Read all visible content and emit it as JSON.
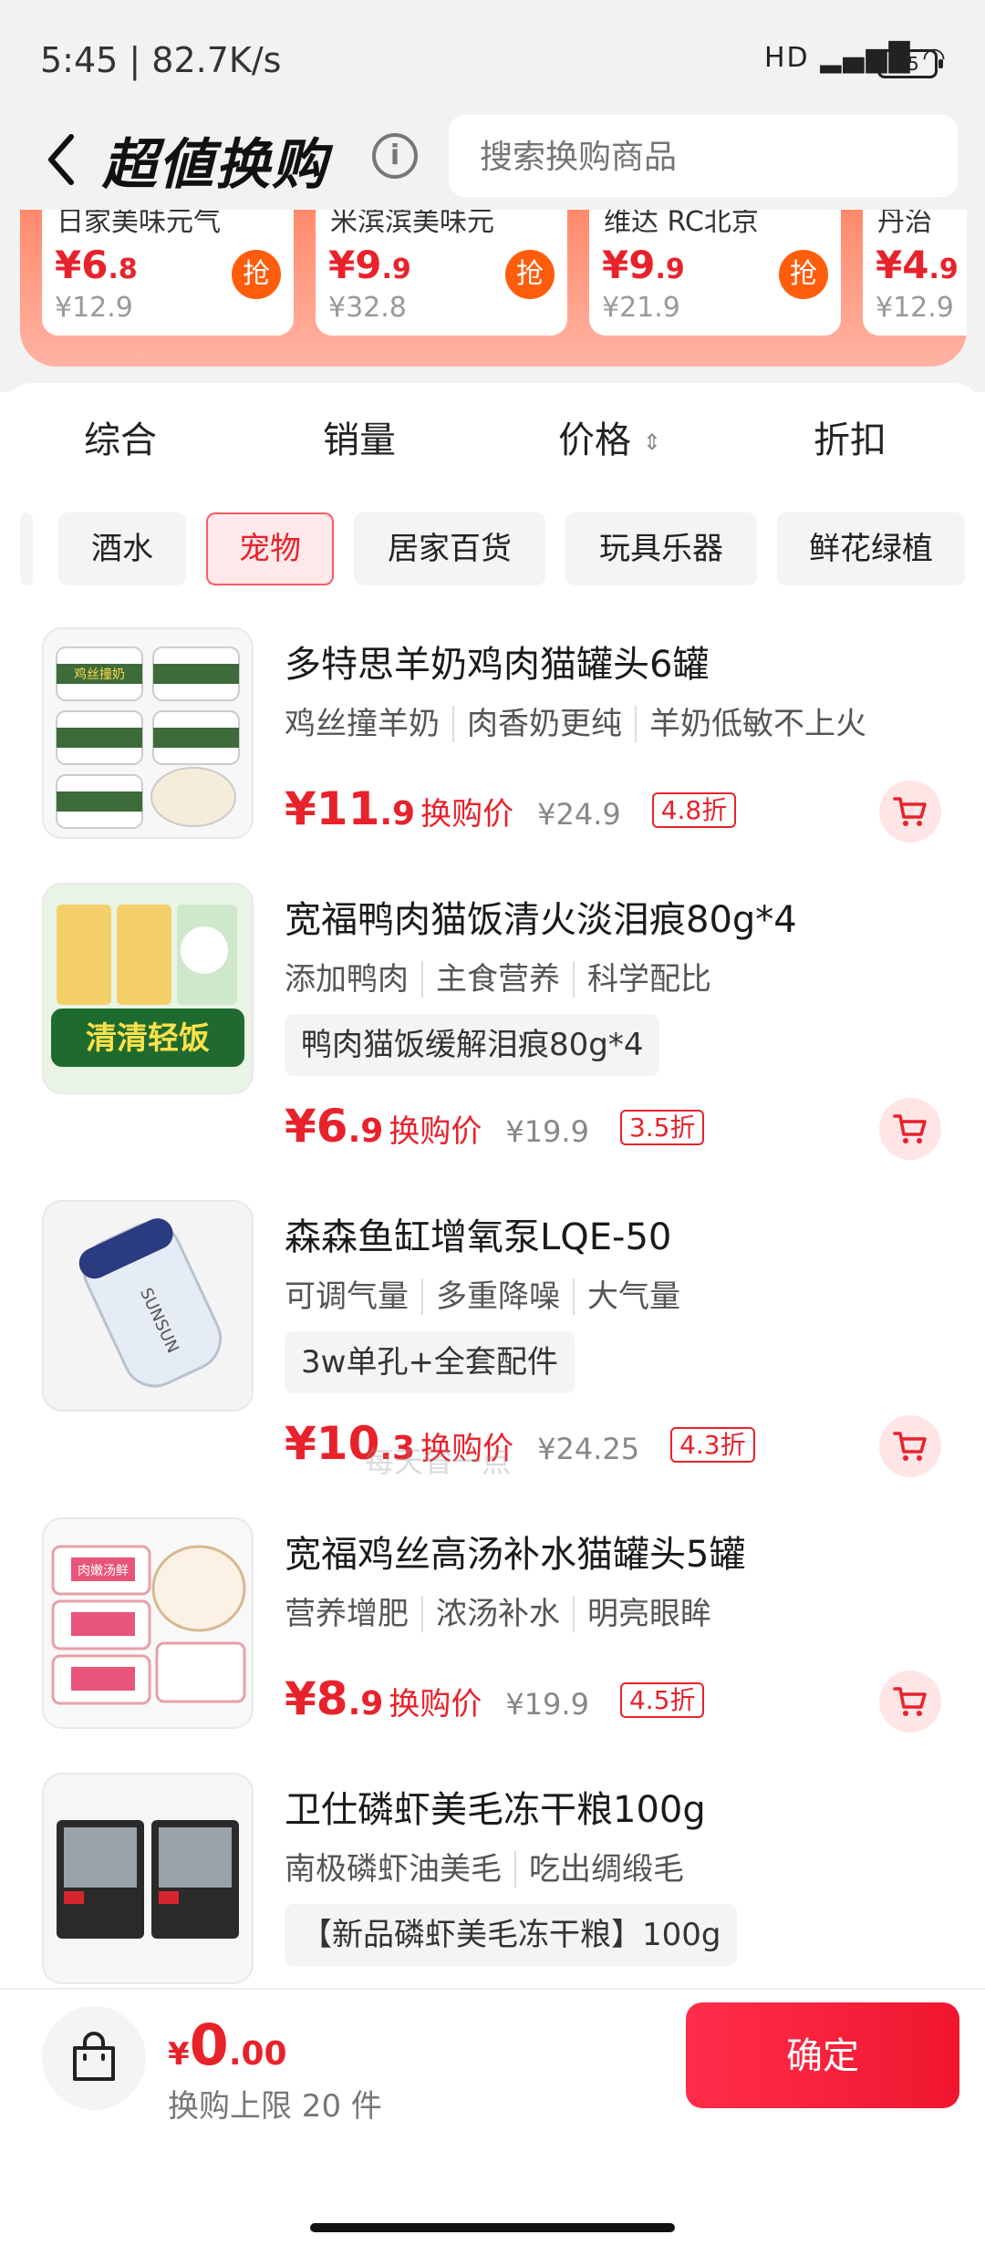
{
  "status_bar": {
    "time": "5:45 | 82.7K/s",
    "signal": "HD ▂▄▆█ ◠",
    "battery": "45"
  },
  "header": {
    "title": "超値换购",
    "search_placeholder": "搜索换购商品"
  },
  "deals": [
    {
      "name": "日家美味元气",
      "price_int": "¥6",
      "price_dec": ".8",
      "old": "¥12.9",
      "grab": "抢"
    },
    {
      "name": "米滨滨美味元",
      "price_int": "¥9",
      "price_dec": ".9",
      "old": "¥32.8",
      "grab": "抢"
    },
    {
      "name": "维达 RC北京",
      "price_int": "¥9",
      "price_dec": ".9",
      "old": "¥21.9",
      "grab": "抢"
    },
    {
      "name": "丹治",
      "price_int": "¥4",
      "price_dec": ".9",
      "old": "¥12.9",
      "grab": ""
    }
  ],
  "sort_tabs": {
    "overall": "综合",
    "sales": "销量",
    "price": "价格",
    "discount": "折扣"
  },
  "categories": [
    "酒水",
    "宠物",
    "居家百货",
    "玩具乐器",
    "鲜花绿植"
  ],
  "products": [
    {
      "name": "多特思羊奶鸡肉猫罐头6罐",
      "tags": [
        "鸡丝撞羊奶",
        "肉香奶更纯",
        "羊奶低敏不上火"
      ],
      "price_int": "¥11",
      "price_dec": ".9",
      "label": "换购价",
      "old": "¥24.9",
      "discount": "4.8折"
    },
    {
      "name": "宽福鸭肉猫饭清火淡泪痕80g*4",
      "tags": [
        "添加鸭肉",
        "主食营养",
        "科学配比"
      ],
      "spec": "鸭肉猫饭缓解泪痕80g*4",
      "price_int": "¥6",
      "price_dec": ".9",
      "label": "换购价",
      "old": "¥19.9",
      "discount": "3.5折"
    },
    {
      "name": "森森鱼缸增氧泵LQE-50",
      "tags": [
        "可调气量",
        "多重降噪",
        "大气量"
      ],
      "spec": "3w单孔+全套配件",
      "price_int": "¥10",
      "price_dec": ".3",
      "label": "换购价",
      "old": "¥24.25",
      "discount": "4.3折"
    },
    {
      "name": "宽福鸡丝高汤补水猫罐头5罐",
      "tags": [
        "营养增肥",
        "浓汤补水",
        "明亮眼眸"
      ],
      "price_int": "¥8",
      "price_dec": ".9",
      "label": "换购价",
      "old": "¥19.9",
      "discount": "4.5折"
    },
    {
      "name": "卫仕磷虾美毛冻干粮100g",
      "tags": [
        "南极磷虾油美毛",
        "吃出绸缎毛"
      ],
      "spec": "【新品磷虾美毛冻干粮】100g"
    }
  ],
  "image_text": {
    "chicken_can": "鸡丝撞奶",
    "duck_bag": "清清轻饭",
    "pump": "SUNSUN",
    "broth_can": "肉嫩汤鲜"
  },
  "watermark": "每天省一点",
  "bottom": {
    "currency": "¥",
    "total_int": "0",
    "total_dec": ".00",
    "limit": "换购上限 20 件",
    "confirm": "确定"
  },
  "colors": {
    "accent": "#e8222b",
    "grab_button": "#ff5c0b",
    "confirm_gradient_start": "#ff2d4a"
  }
}
